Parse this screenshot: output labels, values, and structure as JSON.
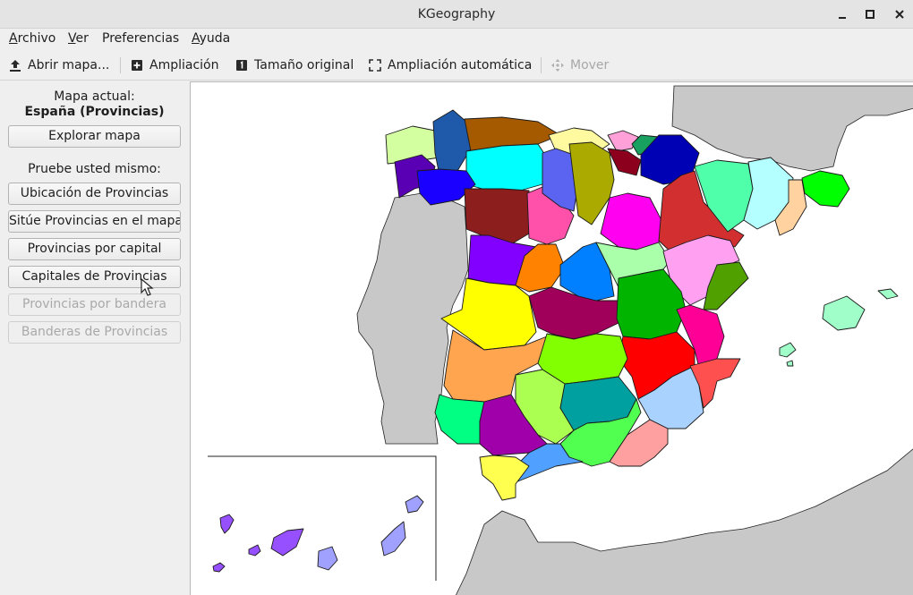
{
  "window": {
    "title": "KGeography"
  },
  "menubar": {
    "items": [
      {
        "label": "Archivo",
        "mnemonic": "A",
        "rest": "rchivo"
      },
      {
        "label": "Ver",
        "mnemonic": "V",
        "rest": "er"
      },
      {
        "label": "Preferencias",
        "mnemonic": "",
        "rest": "Preferencias"
      },
      {
        "label": "Ayuda",
        "mnemonic": "A",
        "rest": "yuda"
      }
    ]
  },
  "toolbar": {
    "open_map": "Abrir mapa...",
    "zoom": "Ampliación",
    "original_size": "Tamaño original",
    "auto_zoom": "Ampliación automática",
    "move": "Mover"
  },
  "side_panel": {
    "current_map_label": "Mapa actual:",
    "current_map_name": "España (Provincias)",
    "explore_button": "Explorar mapa",
    "explore_mnemonic": "x",
    "try_yourself_label": "Pruebe usted mismo:",
    "buttons": [
      {
        "label": "Ubicación de Provincias",
        "enabled": true
      },
      {
        "label": "Sitúe Provincias en el mapa",
        "enabled": true
      },
      {
        "label": "Provincias por capital",
        "enabled": true
      },
      {
        "label": "Capitales de Provincias",
        "enabled": true
      },
      {
        "label": "Provincias por bandera",
        "enabled": false
      },
      {
        "label": "Banderas de Provincias",
        "enabled": false
      }
    ]
  },
  "map": {
    "sea_color": "#ffffff",
    "foreign_land_color": "#c8c8c9",
    "province_colors": [
      "#d4ffa0",
      "#1f5aaa",
      "#a65a00",
      "#fffaa0",
      "#ffa0d8",
      "#18a060",
      "#00ffff",
      "#0000b4",
      "#5a00b4",
      "#1a00ff",
      "#8c1e1e",
      "#ff50aa",
      "#5a64f0",
      "#aaaa00",
      "#8c001e",
      "#ff00f0",
      "#d23030",
      "#50ffaa",
      "#b4ffff",
      "#ffd2a0",
      "#00ff00",
      "#8200ff",
      "#ff8200",
      "#0080ff",
      "#aaffaa",
      "#ffa0f0",
      "#50a000",
      "#ffff00",
      "#a0005a",
      "#00b400",
      "#ff0000",
      "#ff0096",
      "#ffa550",
      "#82ff00",
      "#aaff50",
      "#00a0a0",
      "#aad2ff",
      "#ff5050",
      "#00ff82",
      "#a000aa",
      "#50ff50",
      "#ffa0a0",
      "#50a0ff",
      "#ffff50",
      "#a0ffc8",
      "#9650ff",
      "#a0a0ff"
    ]
  }
}
